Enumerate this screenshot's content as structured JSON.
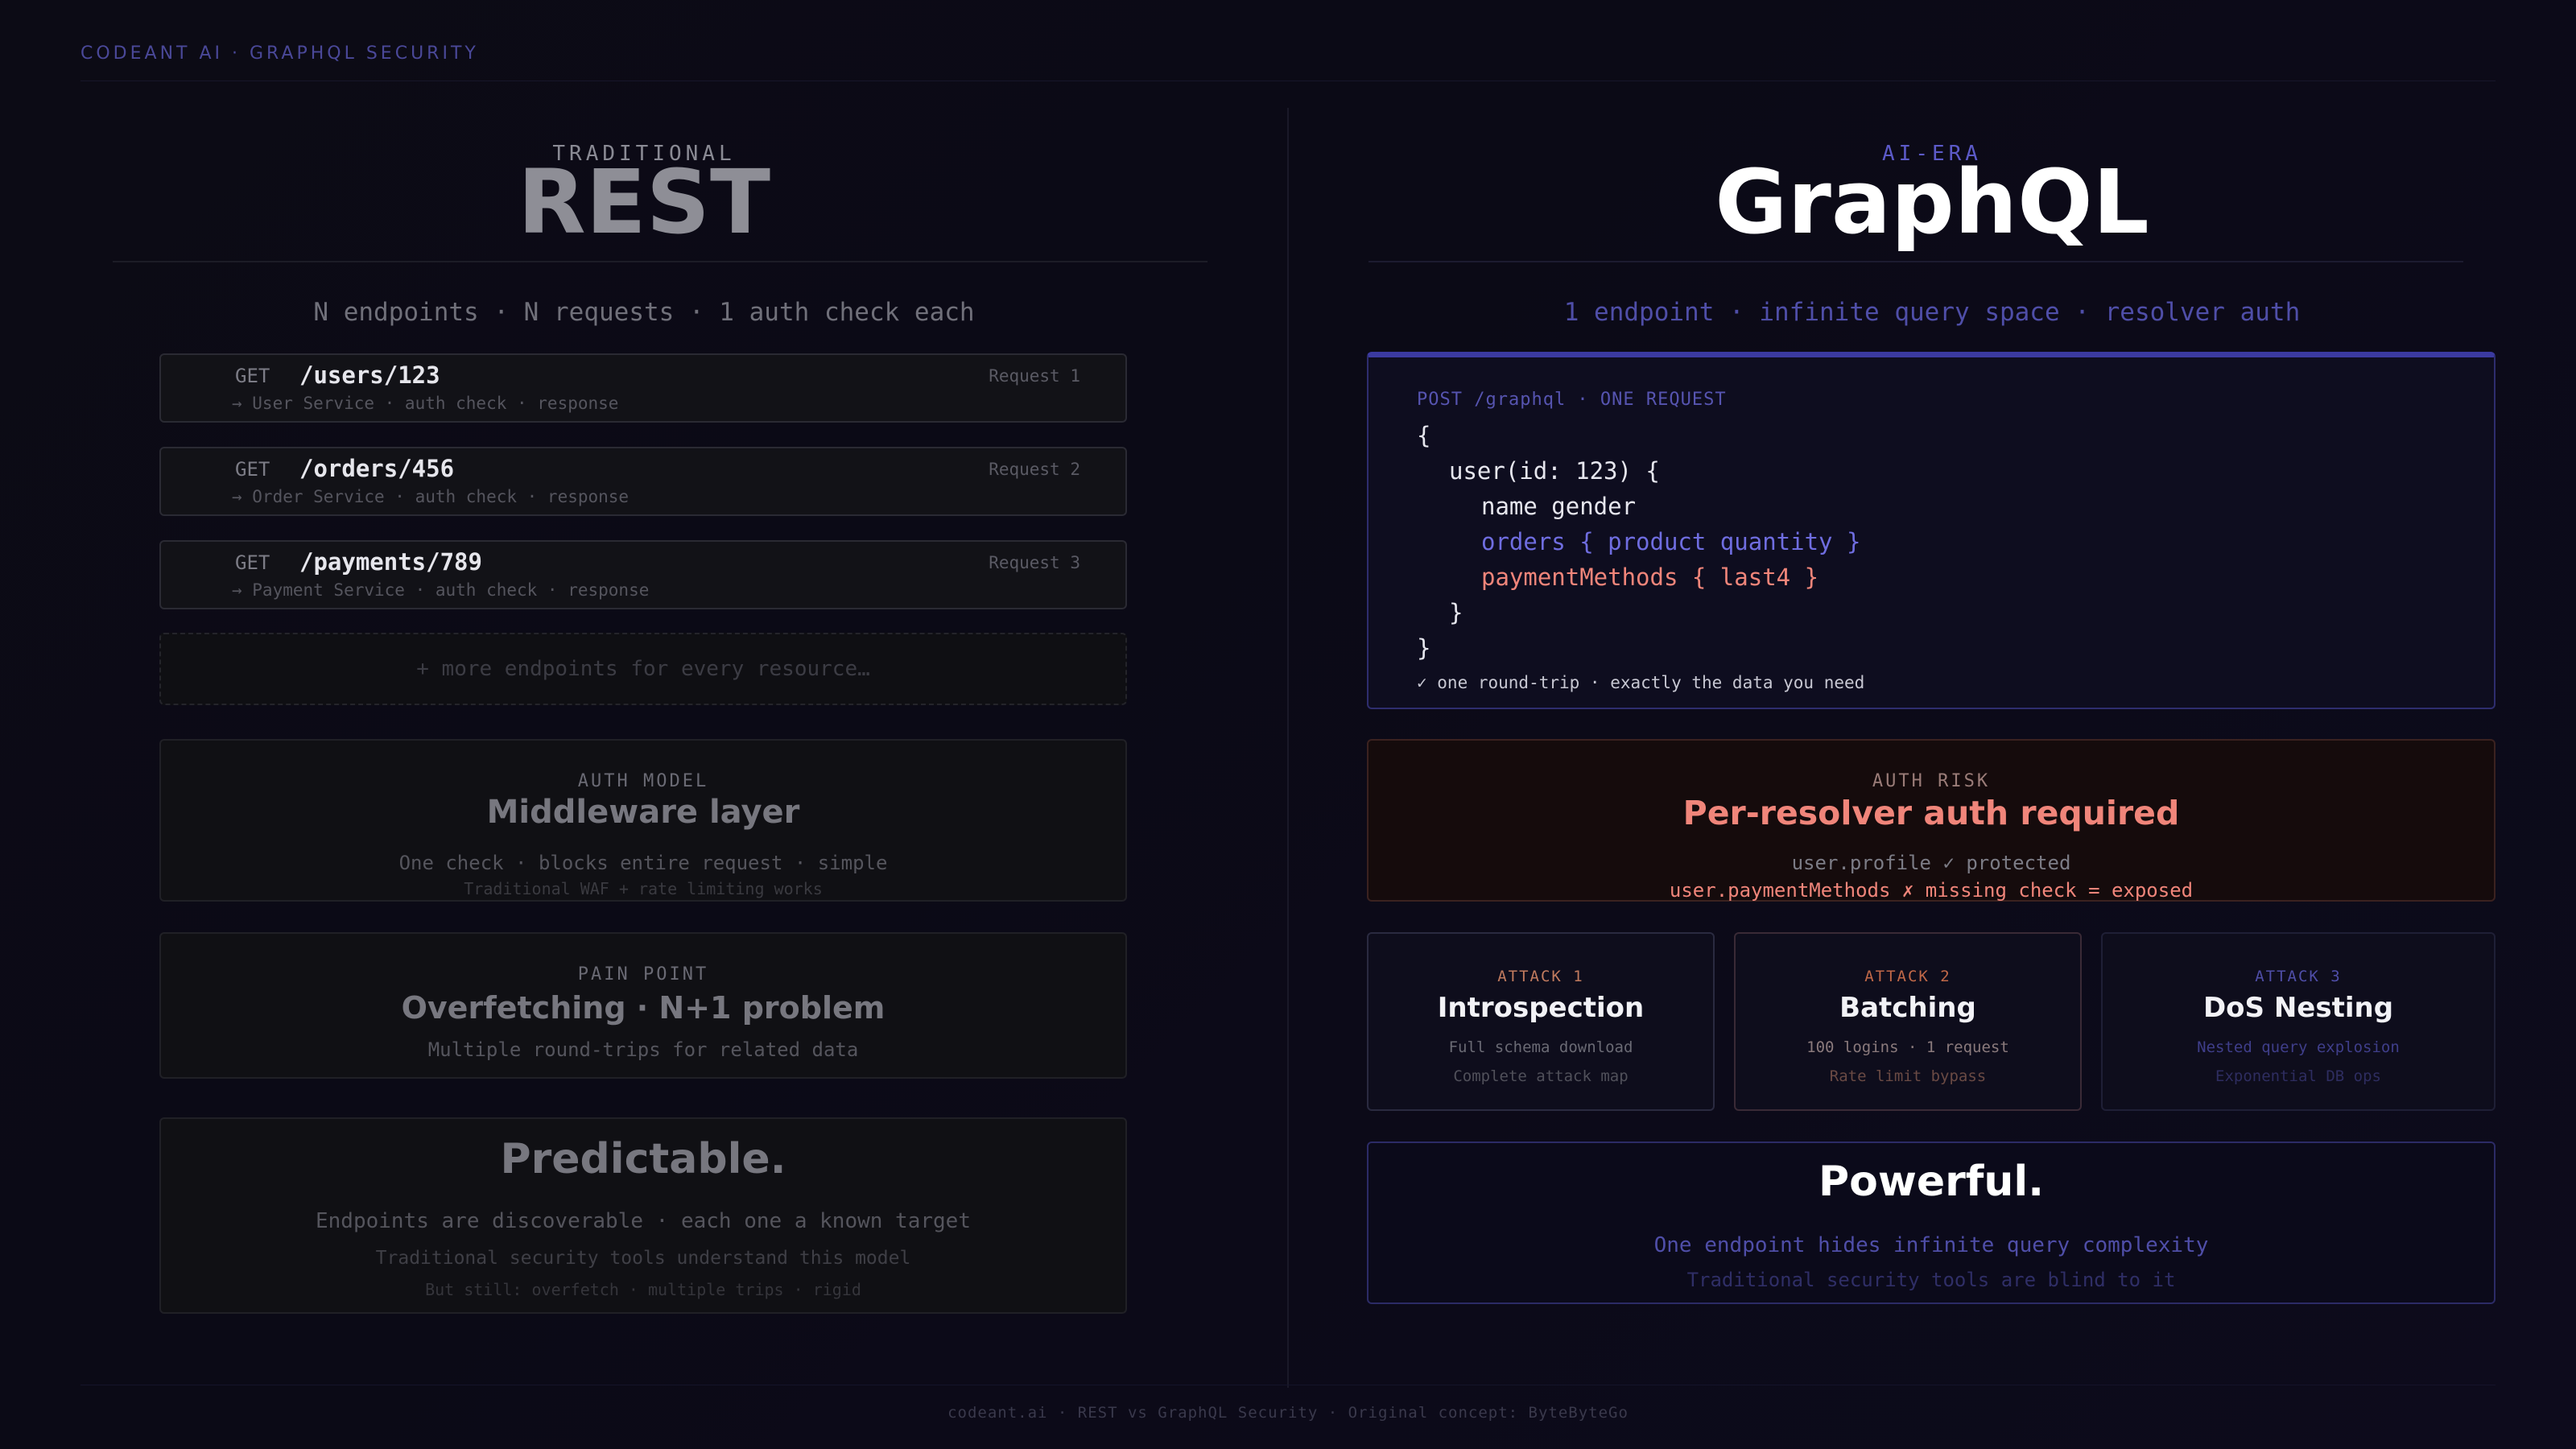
{
  "brand": "CODEANT AI · GRAPHQL SECURITY",
  "rest": {
    "kicker": "TRADITIONAL",
    "title": "REST",
    "tagline": "N endpoints · N requests · 1 auth check each",
    "requests": [
      {
        "method": "GET",
        "path": "/users/123",
        "num": "Request 1",
        "sub": "→ User Service · auth check · response"
      },
      {
        "method": "GET",
        "path": "/orders/456",
        "num": "Request 2",
        "sub": "→ Order Service · auth check · response"
      },
      {
        "method": "GET",
        "path": "/payments/789",
        "num": "Request 3",
        "sub": "→ Payment Service · auth check · response"
      }
    ],
    "more": "+ more endpoints for every resource…",
    "auth": {
      "kicker": "AUTH MODEL",
      "title": "Middleware layer",
      "line": "One check · blocks entire request · simple",
      "faint": "Traditional WAF + rate limiting works"
    },
    "pain": {
      "kicker": "PAIN POINT",
      "title": "Overfetching · N+1 problem",
      "line": "Multiple round-trips for related data"
    },
    "summary": {
      "title": "Predictable.",
      "line": "Endpoints are discoverable · each one a known target",
      "line2": "Traditional security tools understand this model",
      "faint": "But still: overfetch · multiple trips · rigid"
    }
  },
  "graphql": {
    "kicker": "AI-ERA",
    "title": "GraphQL",
    "tagline": "1 endpoint · infinite query space · resolver auth",
    "code_head": "POST /graphql · ONE REQUEST",
    "code": {
      "l1": "{",
      "l2": "user(id: 123) {",
      "l3": "name gender",
      "l4": "orders { product quantity }",
      "l5": "paymentMethods { last4 }",
      "l6": "}",
      "l7": "}"
    },
    "code_foot": "✓ one round-trip · exactly the data you need",
    "risk": {
      "kicker": "AUTH RISK",
      "title": "Per-resolver auth required",
      "line": "user.profile ✓ protected",
      "danger": "user.paymentMethods ✗ missing check = exposed"
    },
    "attacks": [
      {
        "kicker": "ATTACK 1",
        "title": "Introspection",
        "l1": "Full schema download",
        "l2": "Complete attack map"
      },
      {
        "kicker": "ATTACK 2",
        "title": "Batching",
        "l1": "100 logins · 1 request",
        "l2": "Rate limit bypass"
      },
      {
        "kicker": "ATTACK 3",
        "title": "DoS Nesting",
        "l1": "Nested query explosion",
        "l2": "Exponential DB ops"
      }
    ],
    "summary": {
      "title": "Powerful.",
      "line": "One endpoint hides infinite query complexity",
      "faint": "Traditional security tools are blind to it"
    }
  },
  "footer": "codeant.ai · REST vs GraphQL Security · Original concept: ByteByteGo",
  "colors": {
    "accent_blue": "#5c5ac8",
    "danger": "#f0857a",
    "attack2": "#c06848",
    "attack3": "#4f4ea8"
  }
}
